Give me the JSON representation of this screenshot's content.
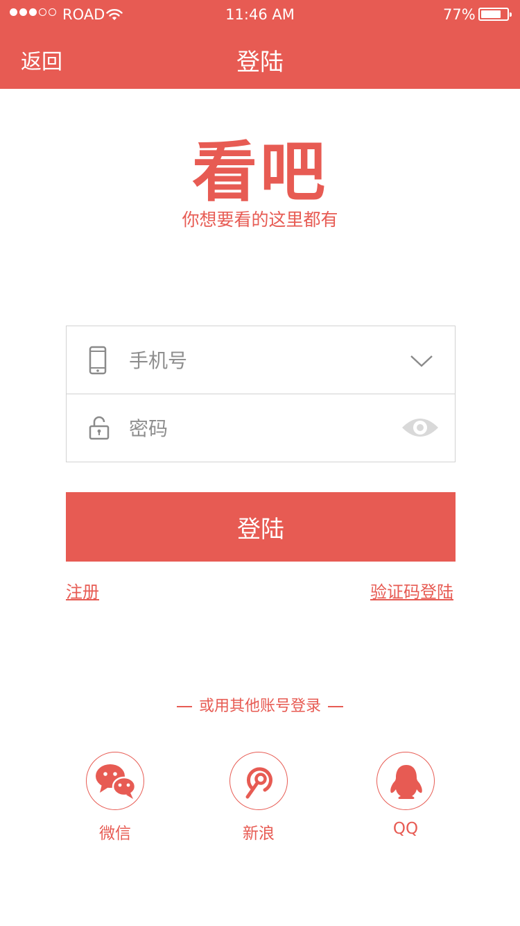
{
  "status_bar": {
    "carrier": "ROAD",
    "time": "11:46 AM",
    "battery_percent": "77%",
    "signal_bars_filled": 3,
    "signal_bars_total": 5,
    "battery_level": 0.77
  },
  "nav": {
    "back_label": "返回",
    "title": "登陆"
  },
  "brand": {
    "name": "看吧",
    "slogan": "你想要看的这里都有"
  },
  "form": {
    "phone": {
      "value": "",
      "placeholder": "手机号",
      "icon": "phone-icon",
      "action_icon": "chevron-down-icon"
    },
    "password": {
      "value": "",
      "placeholder": "密码",
      "icon": "lock-icon",
      "action_icon": "eye-icon"
    }
  },
  "login_button": "登陆",
  "links": {
    "register": "注册",
    "code_login": "验证码登陆"
  },
  "other_login": {
    "label": "或用其他账号登录",
    "providers": [
      {
        "label": "微信",
        "icon": "wechat-icon"
      },
      {
        "label": "新浪",
        "icon": "weibo-icon"
      },
      {
        "label": "QQ",
        "icon": "qq-icon"
      }
    ]
  },
  "colors": {
    "accent": "#e75b53",
    "border": "#d2d2d2",
    "placeholder": "#8e8e8e",
    "icon_gray": "#8a8a8a",
    "eye_gray": "#d9d9d9"
  }
}
